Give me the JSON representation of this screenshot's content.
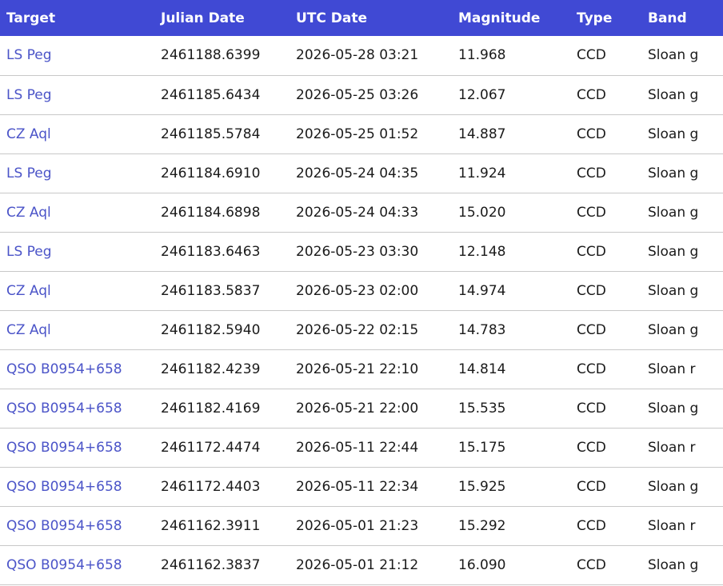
{
  "table": {
    "columns": [
      "Target",
      "Julian Date",
      "UTC Date",
      "Magnitude",
      "Type",
      "Band"
    ],
    "rows": [
      {
        "target": "LS Peg",
        "jd": "2461188.6399",
        "utc": "2026-05-28 03:21",
        "mag": "11.968",
        "type": "CCD",
        "band": "Sloan g"
      },
      {
        "target": "LS Peg",
        "jd": "2461185.6434",
        "utc": "2026-05-25 03:26",
        "mag": "12.067",
        "type": "CCD",
        "band": "Sloan g"
      },
      {
        "target": "CZ Aql",
        "jd": "2461185.5784",
        "utc": "2026-05-25 01:52",
        "mag": "14.887",
        "type": "CCD",
        "band": "Sloan g"
      },
      {
        "target": "LS Peg",
        "jd": "2461184.6910",
        "utc": "2026-05-24 04:35",
        "mag": "11.924",
        "type": "CCD",
        "band": "Sloan g"
      },
      {
        "target": "CZ Aql",
        "jd": "2461184.6898",
        "utc": "2026-05-24 04:33",
        "mag": "15.020",
        "type": "CCD",
        "band": "Sloan g"
      },
      {
        "target": "LS Peg",
        "jd": "2461183.6463",
        "utc": "2026-05-23 03:30",
        "mag": "12.148",
        "type": "CCD",
        "band": "Sloan g"
      },
      {
        "target": "CZ Aql",
        "jd": "2461183.5837",
        "utc": "2026-05-23 02:00",
        "mag": "14.974",
        "type": "CCD",
        "band": "Sloan g"
      },
      {
        "target": "CZ Aql",
        "jd": "2461182.5940",
        "utc": "2026-05-22 02:15",
        "mag": "14.783",
        "type": "CCD",
        "band": "Sloan g"
      },
      {
        "target": "QSO B0954+658",
        "jd": "2461182.4239",
        "utc": "2026-05-21 22:10",
        "mag": "14.814",
        "type": "CCD",
        "band": "Sloan r"
      },
      {
        "target": "QSO B0954+658",
        "jd": "2461182.4169",
        "utc": "2026-05-21 22:00",
        "mag": "15.535",
        "type": "CCD",
        "band": "Sloan g"
      },
      {
        "target": "QSO B0954+658",
        "jd": "2461172.4474",
        "utc": "2026-05-11 22:44",
        "mag": "15.175",
        "type": "CCD",
        "band": "Sloan r"
      },
      {
        "target": "QSO B0954+658",
        "jd": "2461172.4403",
        "utc": "2026-05-11 22:34",
        "mag": "15.925",
        "type": "CCD",
        "band": "Sloan g"
      },
      {
        "target": "QSO B0954+658",
        "jd": "2461162.3911",
        "utc": "2026-05-01 21:23",
        "mag": "15.292",
        "type": "CCD",
        "band": "Sloan r"
      },
      {
        "target": "QSO B0954+658",
        "jd": "2461162.3837",
        "utc": "2026-05-01 21:12",
        "mag": "16.090",
        "type": "CCD",
        "band": "Sloan g"
      }
    ]
  },
  "colors": {
    "header_bg": "#4049d4",
    "link": "#4b54c8"
  }
}
